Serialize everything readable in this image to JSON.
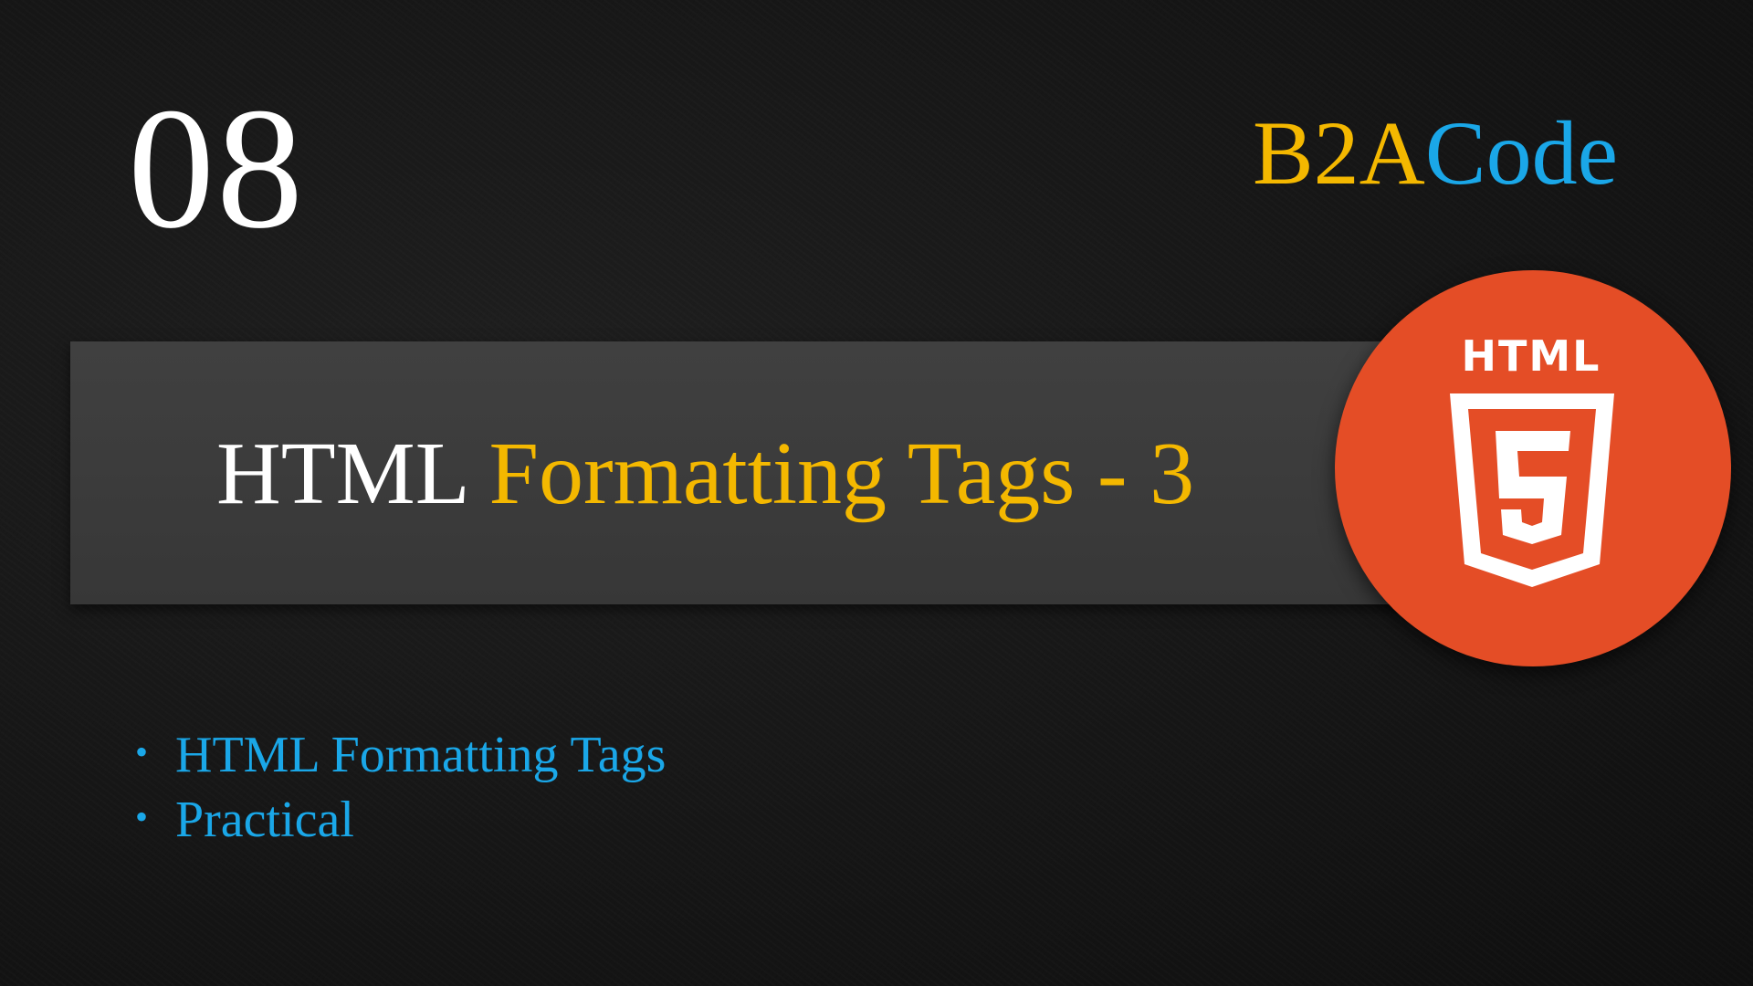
{
  "lesson": {
    "number": "08"
  },
  "brand": {
    "part_a": "B2A",
    "part_b": "Code"
  },
  "title": {
    "white": "HTML",
    "yellow": "Formatting Tags - 3"
  },
  "logo": {
    "word": "HTML",
    "shield_digit": "5",
    "icon": "html5-icon"
  },
  "bullets": [
    {
      "symbol": "•",
      "text": "HTML Formatting Tags"
    },
    {
      "symbol": "•",
      "text": "Practical"
    }
  ],
  "colors": {
    "background": "#141414",
    "band": "#3c3c3c",
    "accent_yellow": "#f4b800",
    "accent_blue": "#1aa7e8",
    "logo_orange": "#e44d26",
    "white": "#ffffff"
  }
}
